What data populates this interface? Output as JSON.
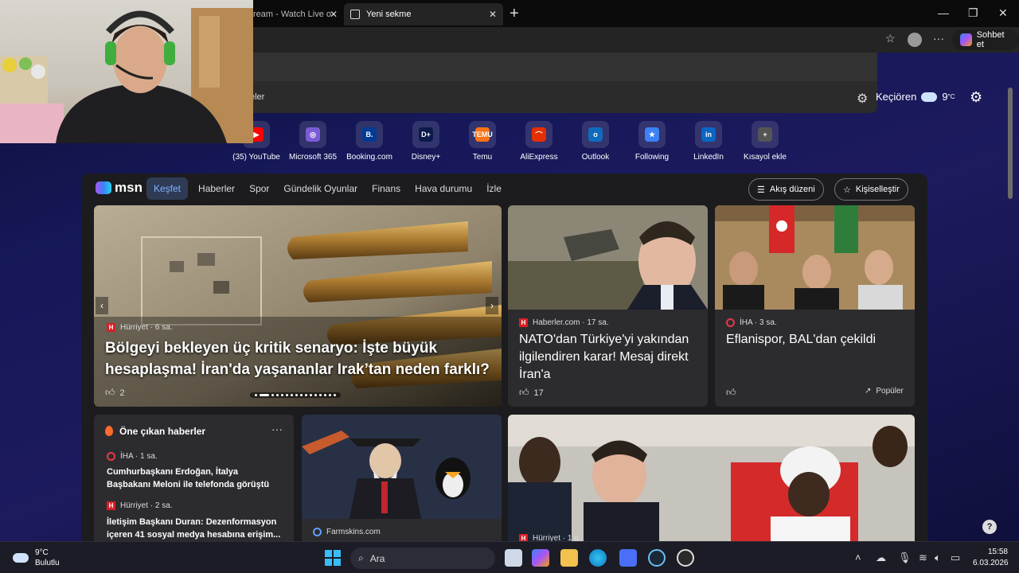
{
  "browser": {
    "tabs": [
      {
        "label": "ream - Watch Live o"
      },
      {
        "label": "Yeni sekme"
      }
    ],
    "new_tab_symbol": "+",
    "window_controls": {
      "minimize": "—",
      "maximize": "❐",
      "close": "✕"
    },
    "copilot_label": "Sohbet et"
  },
  "search_panel": {
    "suggestion_fragment": "eler"
  },
  "ntp": {
    "weather": {
      "location": "Keçiören",
      "temp": "9",
      "unit": "°C"
    },
    "quick_links": [
      {
        "label": "(35) YouTube",
        "color": "#ff0000",
        "glyph": "▶"
      },
      {
        "label": "Microsoft 365",
        "color": "#7b5cd6",
        "glyph": "◎"
      },
      {
        "label": "Booking.com",
        "color": "#003b95",
        "glyph": "B."
      },
      {
        "label": "Disney+",
        "color": "#0b1a4a",
        "glyph": "D+"
      },
      {
        "label": "Temu",
        "color": "#f97316",
        "glyph": "TEMU"
      },
      {
        "label": "AliExpress",
        "color": "#e62e04",
        "glyph": "⌒"
      },
      {
        "label": "Outlook",
        "color": "#0f6cbd",
        "glyph": "o"
      },
      {
        "label": "Following",
        "color": "#3b82f6",
        "glyph": "★"
      },
      {
        "label": "LinkedIn",
        "color": "#0a66c2",
        "glyph": "in"
      },
      {
        "label": "Kısayol ekle",
        "color": "#555555",
        "glyph": "+"
      }
    ]
  },
  "feed": {
    "logo": "msn",
    "tabs": [
      "Keşfet",
      "Haberler",
      "Spor",
      "Gündelik Oyunlar",
      "Finans",
      "Hava durumu",
      "İzle"
    ],
    "layout_button": "Akış düzeni",
    "personalize_button": "Kişiselleştir",
    "hero": {
      "source": "Hürriyet · 6 sa.",
      "title": "Bölgeyi bekleyen üç kritik senaryo: İşte büyük hesaplaşma! İran'da yaşananlar Irak’tan neden farklı?",
      "likes": "2"
    },
    "card2": {
      "source": "Haberler.com · 17 sa.",
      "title": "NATO'dan Türkiye'yi yakından ilgilendiren karar! Mesaj direkt İran'a",
      "likes": "17"
    },
    "card3": {
      "source": "İHA · 3 sa.",
      "title": "Eflanispor, BAL'dan çekildi",
      "tag": "Popüler"
    },
    "top_news": {
      "title": "Öne çıkan haberler",
      "more": "···",
      "items": [
        {
          "source": "İHA · 1 sa.",
          "title": "Cumhurbaşkanı Erdoğan, İtalya Başbakanı Meloni ile telefonda görüştü"
        },
        {
          "source": "Hürriyet · 2 sa.",
          "title": "İletişim Başkanı Duran: Dezenformasyon içeren 41 sosyal medya hesabına erişim..."
        }
      ]
    },
    "card5": {
      "source": "Farmskins.com"
    },
    "card6": {
      "source": "Hürriyet · 1 g."
    }
  },
  "taskbar": {
    "weather_temp": "9°C",
    "weather_desc": "Bulutlu",
    "search_label": "Ara",
    "time": "15:58",
    "date": "6.03.2026"
  }
}
